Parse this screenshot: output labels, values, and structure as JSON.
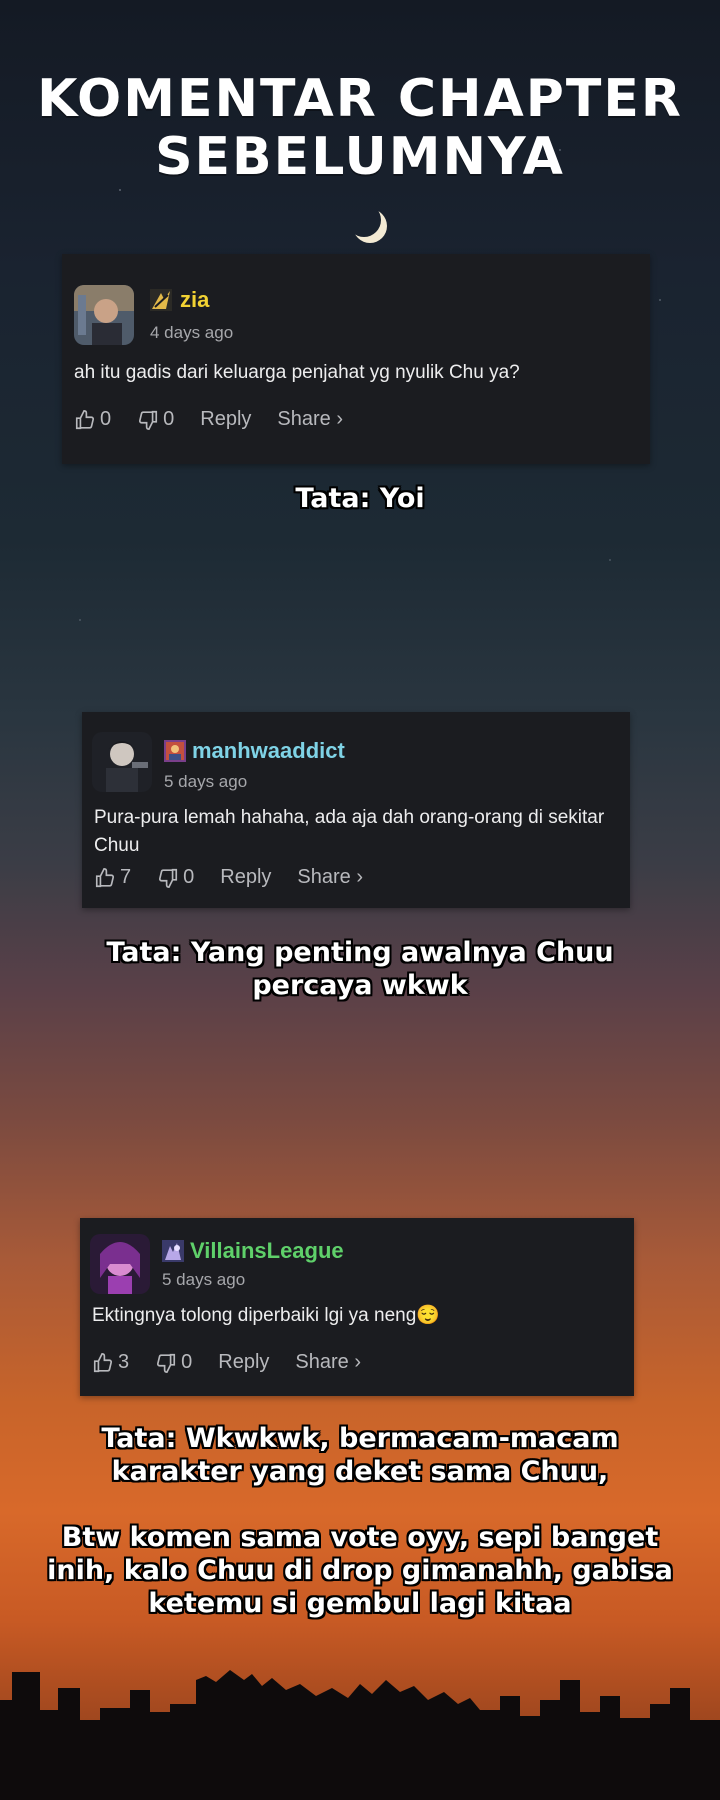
{
  "title": {
    "line1": "KOMENTAR CHAPTER",
    "line2": "SEBELUMNYA"
  },
  "comments": [
    {
      "username": "zia",
      "username_color": "#f2d233",
      "time": "4 days ago",
      "text": "ah itu gadis dari keluarga penjahat yg nyulik Chu ya?",
      "likes": "0",
      "dislikes": "0",
      "reply_label": "Reply",
      "share_label": "Share ›",
      "caption": "Tata: Yoi"
    },
    {
      "username": "manhwaaddict",
      "username_color": "#7fd3e6",
      "time": "5 days ago",
      "text": "Pura-pura lemah hahaha, ada aja dah orang-orang di sekitar Chuu",
      "likes": "7",
      "dislikes": "0",
      "reply_label": "Reply",
      "share_label": "Share ›",
      "caption": "Tata: Yang penting awalnya Chuu\npercaya wkwk"
    },
    {
      "username": "VillainsLeague",
      "username_color": "#5fd06a",
      "time": "5 days ago",
      "text": "Ektingnya tolong diperbaiki lgi ya neng😌",
      "likes": "3",
      "dislikes": "0",
      "reply_label": "Reply",
      "share_label": "Share ›",
      "caption": "Tata: Wkwkwk, bermacam-macam\nkarakter yang deket sama Chuu,\n\nBtw komen sama vote oyy, sepi banget\ninih, kalo Chuu di drop gimanahh, gabisa\nketemu si gembul lagi kitaa"
    }
  ],
  "icons": {
    "like": "thumbs-up-icon",
    "dislike": "thumbs-down-icon",
    "moon": "crescent-moon-icon"
  }
}
